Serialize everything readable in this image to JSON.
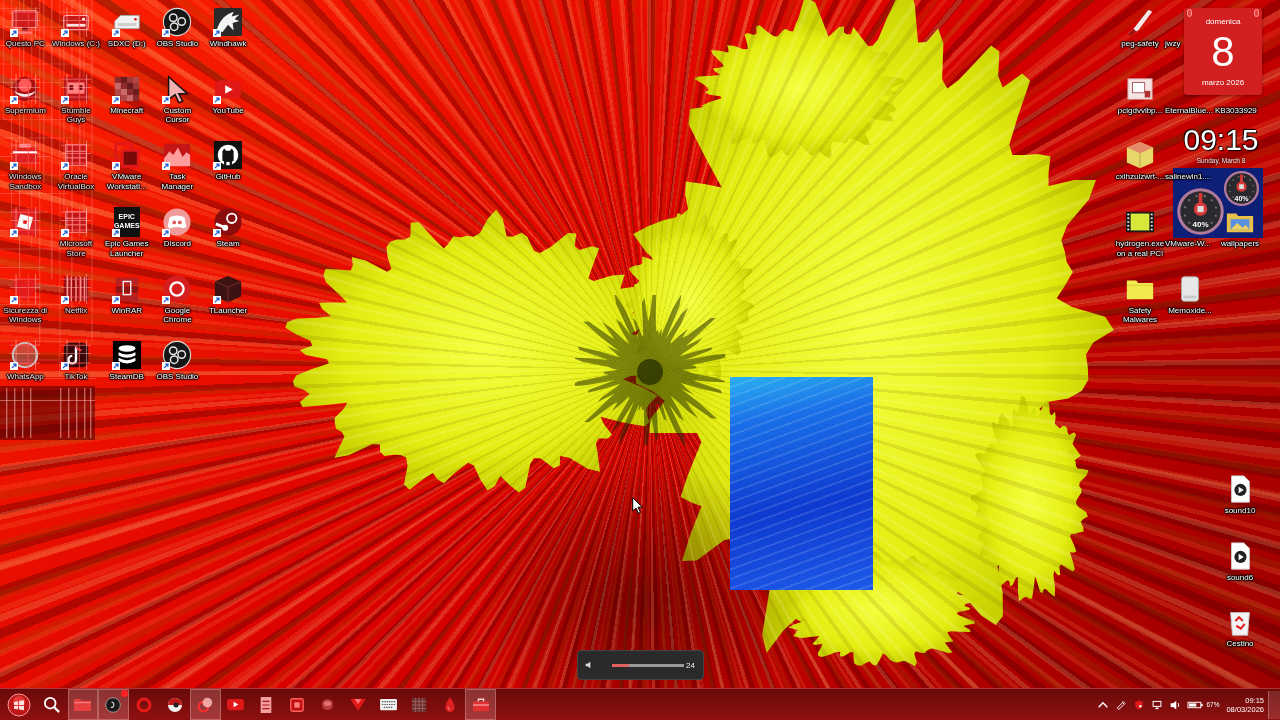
{
  "left_icons": [
    {
      "label": "Questo PC",
      "kind": "monitor",
      "glitched": true,
      "shortcut": true
    },
    {
      "label": "Windows (C:)",
      "kind": "drive",
      "glitched": true,
      "shortcut": true
    },
    {
      "label": "SDXC (D:)",
      "kind": "sdcard",
      "glitched": false,
      "shortcut": true
    },
    {
      "label": "OBS Studio",
      "kind": "obs",
      "glitched": false,
      "shortcut": true
    },
    {
      "label": "Windhawk",
      "kind": "eagle",
      "glitched": false,
      "shortcut": true
    },
    {
      "label": "Supermium",
      "kind": "sphere",
      "glitched": true,
      "shortcut": true
    },
    {
      "label": "Stumble Guys",
      "kind": "faces",
      "glitched": true,
      "shortcut": true
    },
    {
      "label": "Minecraft",
      "kind": "pixels",
      "glitched": false,
      "shortcut": true
    },
    {
      "label": "Custom Cursor",
      "kind": "cursor",
      "glitched": false,
      "shortcut": true
    },
    {
      "label": "YouTube",
      "kind": "play",
      "glitched": false,
      "shortcut": true
    },
    {
      "label": "Windows Sandbox",
      "kind": "sandbox",
      "glitched": true,
      "shortcut": true
    },
    {
      "label": "Oracle VirtualBox",
      "kind": "grid",
      "glitched": true,
      "shortcut": true
    },
    {
      "label": "VMware Workstati...",
      "kind": "squares",
      "glitched": false,
      "shortcut": true
    },
    {
      "label": "Task Manager",
      "kind": "chart",
      "glitched": false,
      "shortcut": true
    },
    {
      "label": "GitHub",
      "kind": "cat",
      "glitched": false,
      "shortcut": true
    },
    {
      "kind": "tilted",
      "glitched": true,
      "shortcut": true
    },
    {
      "label": "Microsoft Store",
      "kind": "grid",
      "glitched": true,
      "shortcut": true
    },
    {
      "label": "Epic Games Launcher",
      "kind": "wordmark",
      "logo_text": "EPIC GAMES",
      "glitched": false,
      "shortcut": true
    },
    {
      "label": "Discord",
      "kind": "controller",
      "glitched": false,
      "shortcut": true
    },
    {
      "label": "Steam",
      "kind": "steam",
      "glitched": false,
      "shortcut": true
    },
    {
      "label": "Sicurezza di Windows",
      "kind": "heart",
      "glitched": true,
      "shortcut": true
    },
    {
      "label": "Netflix",
      "kind": "bars",
      "glitched": true,
      "shortcut": true
    },
    {
      "label": "WinRAR",
      "kind": "books",
      "glitched": false,
      "shortcut": true
    },
    {
      "label": "Google Chrome",
      "kind": "ring",
      "glitched": false,
      "shortcut": true
    },
    {
      "label": "TLauncher",
      "kind": "block",
      "glitched": false,
      "shortcut": true
    },
    {
      "label": "WhatsApp",
      "kind": "chat",
      "glitched": true,
      "shortcut": true
    },
    {
      "label": "TikTok",
      "kind": "note",
      "glitched": true,
      "shortcut": true
    },
    {
      "label": "SteamDB",
      "kind": "discs",
      "glitched": false,
      "shortcut": true
    },
    {
      "label": "OBS Studio",
      "kind": "obs",
      "glitched": false,
      "shortcut": true
    }
  ],
  "right_icon_rows": [
    [
      {
        "label": "peg-safety",
        "kind": "knife",
        "covered": false
      },
      {
        "label": "jwzy",
        "covered": true
      }
    ],
    [
      {
        "label": "pcigdvvibp...",
        "kind": "photo",
        "covered": false
      },
      {
        "label": "EternalBlue...",
        "covered": true
      },
      {
        "label": "KB3033929",
        "covered": true
      }
    ],
    [
      {
        "label": "cxlhzulzwrt-...",
        "kind": "cube",
        "covered": false
      },
      {
        "label": "salinewin1....",
        "covered": true
      }
    ],
    [
      {
        "label": "hydrogen.exe on a real PC!",
        "kind": "film",
        "covered": false
      },
      {
        "label": "VMware-W...",
        "covered": true
      },
      {
        "label": "wallpapers",
        "kind": "imagefolder",
        "covered": false
      }
    ],
    [
      {
        "label": "Safety Malwares",
        "kind": "folder",
        "covered": false
      },
      {
        "label": "Memoxide...",
        "kind": "hdd",
        "covered": false
      }
    ]
  ],
  "right_bottom_icons": [
    {
      "label": "sound10",
      "kind": "audio"
    },
    {
      "label": "sound6",
      "kind": "audio"
    },
    {
      "label": "Cestino",
      "kind": "bin"
    }
  ],
  "calendar_widget": {
    "weekday": "domenica",
    "day": "8",
    "month_year": "marzo 2026"
  },
  "clock_widget": {
    "time": "09:15",
    "date": "Sunday, March 8"
  },
  "gauge_widget": {
    "gauges": [
      {
        "reading": "40%"
      },
      {
        "reading": "40%"
      }
    ]
  },
  "volume_flyout": {
    "level": 0.24,
    "reading": "24"
  },
  "taskbar": {
    "apps": [
      {
        "kind": "orb",
        "active": false
      },
      {
        "kind": "search",
        "active": false
      },
      {
        "kind": "folder",
        "active": true
      },
      {
        "kind": "obs",
        "active": true,
        "badge": true
      },
      {
        "kind": "ring",
        "active": false
      },
      {
        "kind": "ball",
        "active": false
      },
      {
        "kind": "circles",
        "active": true
      },
      {
        "kind": "play",
        "active": false
      },
      {
        "kind": "notepad",
        "active": false
      },
      {
        "kind": "square",
        "active": false
      },
      {
        "kind": "faded",
        "active": false
      },
      {
        "kind": "wedge",
        "active": false
      },
      {
        "kind": "keyboard",
        "active": false
      },
      {
        "kind": "mosaic",
        "active": false
      },
      {
        "kind": "drop",
        "active": false
      },
      {
        "kind": "briefcase",
        "active": true
      }
    ],
    "tray": {
      "icons": [
        {
          "kind": "chevron"
        },
        {
          "kind": "pen"
        },
        {
          "kind": "shield"
        },
        {
          "kind": "network"
        },
        {
          "kind": "speaker"
        }
      ],
      "battery_text": "67%",
      "time": "09:15",
      "date": "08/03/2026"
    }
  }
}
